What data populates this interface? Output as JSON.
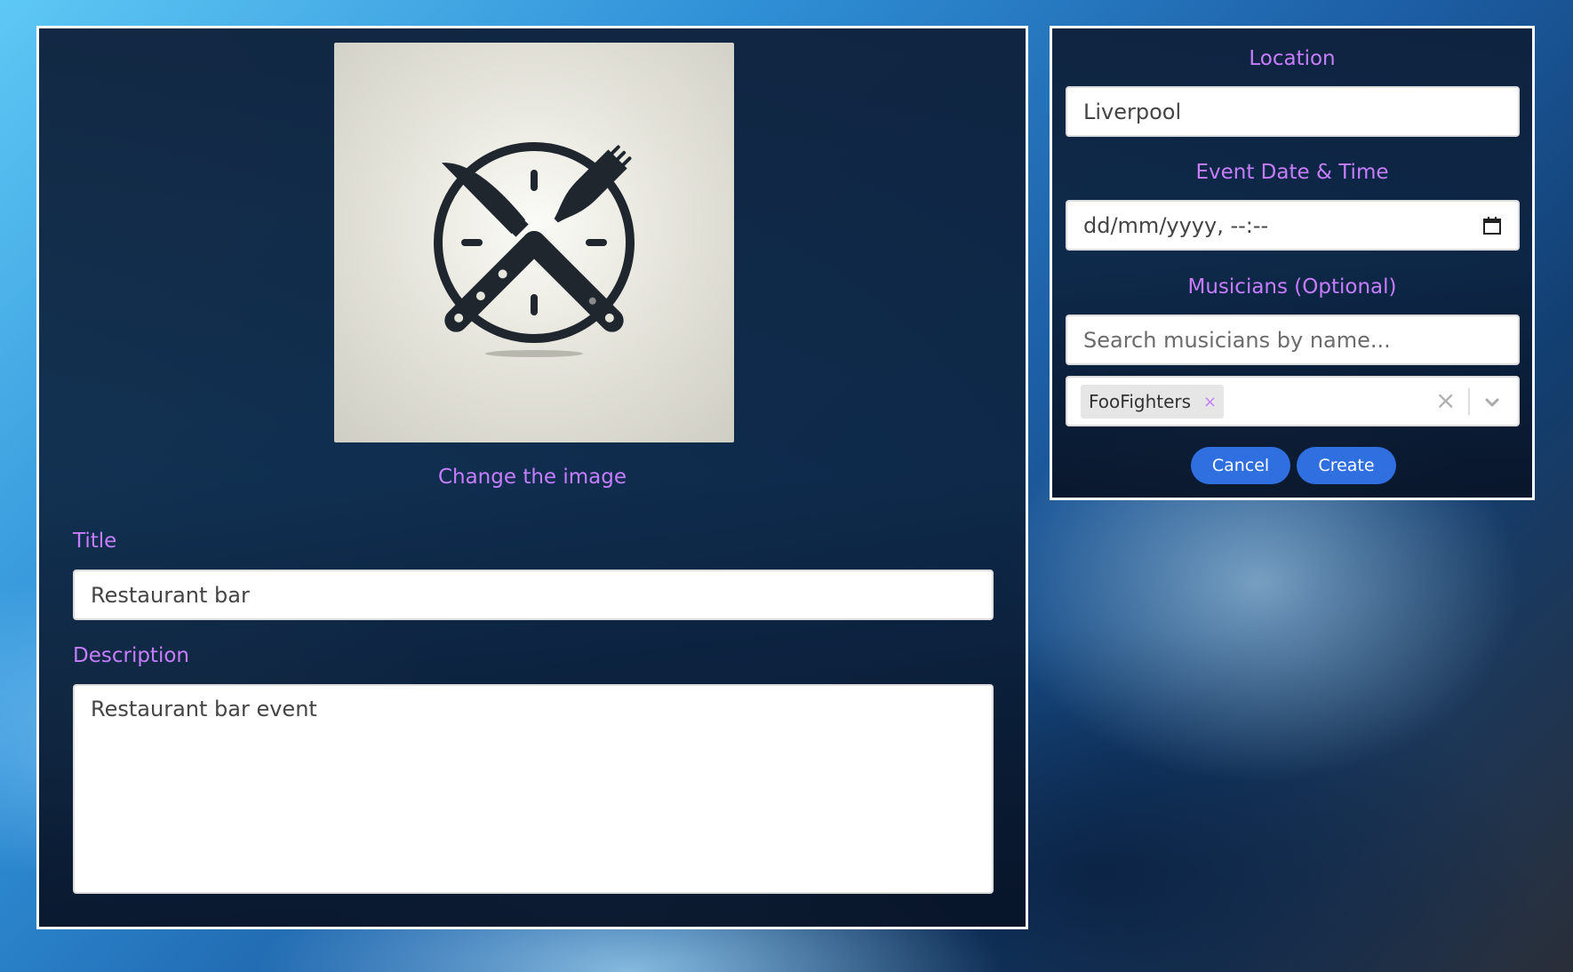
{
  "image_section": {
    "icon": "fork-knife-clock-icon",
    "change_link": "Change the image"
  },
  "title_field": {
    "label": "Title",
    "value": "Restaurant bar"
  },
  "description_field": {
    "label": "Description",
    "value": "Restaurant bar event"
  },
  "location_field": {
    "label": "Location",
    "value": "Liverpool"
  },
  "datetime_field": {
    "label": "Event Date & Time",
    "placeholder": "dd/mm/yyyy, --:--",
    "icon": "calendar-icon"
  },
  "musicians_field": {
    "label": "Musicians (Optional)",
    "search_placeholder": "Search musicians by name...",
    "selected": [
      {
        "name": "FooFighters",
        "remove": "×"
      }
    ],
    "clear_icon": "×"
  },
  "actions": {
    "cancel": "Cancel",
    "create": "Create"
  },
  "colors": {
    "label_accent": "#c77dff",
    "button": "#2f6fe0",
    "panel_border": "#ffffff"
  }
}
